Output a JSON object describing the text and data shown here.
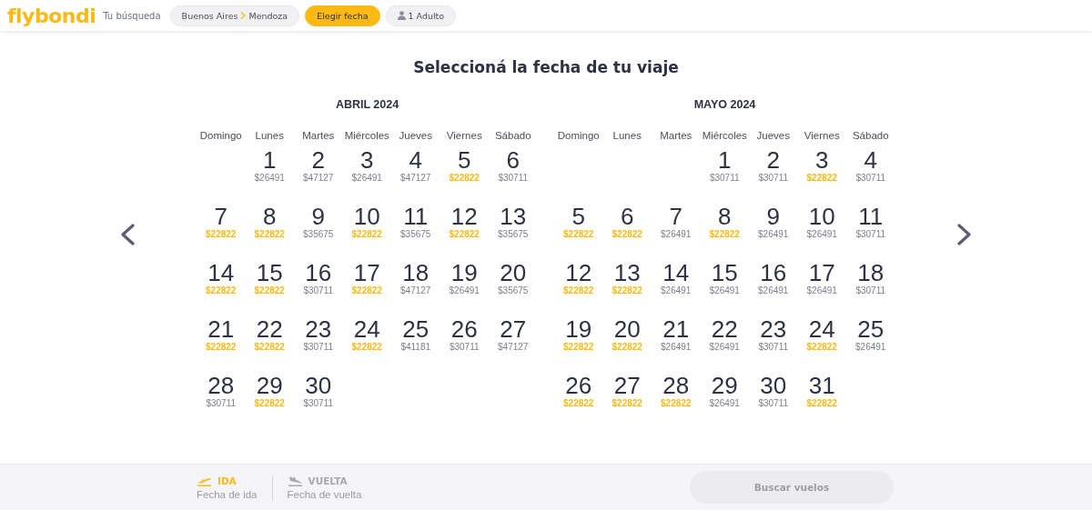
{
  "header": {
    "logo": "flybondi",
    "search_label": "Tu búsqueda",
    "route": {
      "origin": "Buenos Aires",
      "destination": "Mendoza",
      "selected": false
    },
    "date_button": {
      "label": "Elegir fecha",
      "selected": true
    },
    "passengers": {
      "label": "1 Adulto",
      "selected": false
    }
  },
  "title": "Seleccioná la fecha de tu viaje",
  "months": [
    {
      "name": "ABRIL 2024",
      "weekdays": [
        "Domingo",
        "Lunes",
        "Martes",
        "Miércoles",
        "Jueves",
        "Viernes",
        "Sábado"
      ],
      "days": [
        {
          "kind": "blank"
        },
        {
          "kind": "day",
          "day": "1",
          "price": "$26491",
          "cheapest": false
        },
        {
          "kind": "day",
          "day": "2",
          "price": "$47127",
          "cheapest": false
        },
        {
          "kind": "day",
          "day": "3",
          "price": "$26491",
          "cheapest": false
        },
        {
          "kind": "day",
          "day": "4",
          "price": "$47127",
          "cheapest": false
        },
        {
          "kind": "day",
          "day": "5",
          "price": "$22822",
          "cheapest": true
        },
        {
          "kind": "day",
          "day": "6",
          "price": "$30711",
          "cheapest": false
        },
        {
          "kind": "day",
          "day": "7",
          "price": "$22822",
          "cheapest": true
        },
        {
          "kind": "day",
          "day": "8",
          "price": "$22822",
          "cheapest": true
        },
        {
          "kind": "day",
          "day": "9",
          "price": "$35675",
          "cheapest": false
        },
        {
          "kind": "day",
          "day": "10",
          "price": "$22822",
          "cheapest": true
        },
        {
          "kind": "day",
          "day": "11",
          "price": "$35675",
          "cheapest": false
        },
        {
          "kind": "day",
          "day": "12",
          "price": "$22822",
          "cheapest": true
        },
        {
          "kind": "day",
          "day": "13",
          "price": "$35675",
          "cheapest": false
        },
        {
          "kind": "day",
          "day": "14",
          "price": "$22822",
          "cheapest": true
        },
        {
          "kind": "day",
          "day": "15",
          "price": "$22822",
          "cheapest": true
        },
        {
          "kind": "day",
          "day": "16",
          "price": "$30711",
          "cheapest": false
        },
        {
          "kind": "day",
          "day": "17",
          "price": "$22822",
          "cheapest": true
        },
        {
          "kind": "day",
          "day": "18",
          "price": "$47127",
          "cheapest": false
        },
        {
          "kind": "day",
          "day": "19",
          "price": "$26491",
          "cheapest": false
        },
        {
          "kind": "day",
          "day": "20",
          "price": "$35675",
          "cheapest": false
        },
        {
          "kind": "day",
          "day": "21",
          "price": "$22822",
          "cheapest": true
        },
        {
          "kind": "day",
          "day": "22",
          "price": "$22822",
          "cheapest": true
        },
        {
          "kind": "day",
          "day": "23",
          "price": "$30711",
          "cheapest": false
        },
        {
          "kind": "day",
          "day": "24",
          "price": "$22822",
          "cheapest": true
        },
        {
          "kind": "day",
          "day": "25",
          "price": "$41181",
          "cheapest": false
        },
        {
          "kind": "day",
          "day": "26",
          "price": "$30711",
          "cheapest": false
        },
        {
          "kind": "day",
          "day": "27",
          "price": "$47127",
          "cheapest": false
        },
        {
          "kind": "day",
          "day": "28",
          "price": "$30711",
          "cheapest": false
        },
        {
          "kind": "day",
          "day": "29",
          "price": "$22822",
          "cheapest": true
        },
        {
          "kind": "day",
          "day": "30",
          "price": "$30711",
          "cheapest": false
        }
      ]
    },
    {
      "name": "MAYO 2024",
      "weekdays": [
        "Domingo",
        "Lunes",
        "Martes",
        "Miércoles",
        "Jueves",
        "Viernes",
        "Sábado"
      ],
      "days": [
        {
          "kind": "blank"
        },
        {
          "kind": "blank"
        },
        {
          "kind": "blank"
        },
        {
          "kind": "day",
          "day": "1",
          "price": "$30711",
          "cheapest": false
        },
        {
          "kind": "day",
          "day": "2",
          "price": "$30711",
          "cheapest": false
        },
        {
          "kind": "day",
          "day": "3",
          "price": "$22822",
          "cheapest": true
        },
        {
          "kind": "day",
          "day": "4",
          "price": "$30711",
          "cheapest": false
        },
        {
          "kind": "day",
          "day": "5",
          "price": "$22822",
          "cheapest": true
        },
        {
          "kind": "day",
          "day": "6",
          "price": "$22822",
          "cheapest": true
        },
        {
          "kind": "day",
          "day": "7",
          "price": "$26491",
          "cheapest": false
        },
        {
          "kind": "day",
          "day": "8",
          "price": "$22822",
          "cheapest": true
        },
        {
          "kind": "day",
          "day": "9",
          "price": "$26491",
          "cheapest": false
        },
        {
          "kind": "day",
          "day": "10",
          "price": "$26491",
          "cheapest": false
        },
        {
          "kind": "day",
          "day": "11",
          "price": "$30711",
          "cheapest": false
        },
        {
          "kind": "day",
          "day": "12",
          "price": "$22822",
          "cheapest": true
        },
        {
          "kind": "day",
          "day": "13",
          "price": "$22822",
          "cheapest": true
        },
        {
          "kind": "day",
          "day": "14",
          "price": "$26491",
          "cheapest": false
        },
        {
          "kind": "day",
          "day": "15",
          "price": "$26491",
          "cheapest": false
        },
        {
          "kind": "day",
          "day": "16",
          "price": "$26491",
          "cheapest": false
        },
        {
          "kind": "day",
          "day": "17",
          "price": "$26491",
          "cheapest": false
        },
        {
          "kind": "day",
          "day": "18",
          "price": "$30711",
          "cheapest": false
        },
        {
          "kind": "day",
          "day": "19",
          "price": "$22822",
          "cheapest": true
        },
        {
          "kind": "day",
          "day": "20",
          "price": "$22822",
          "cheapest": true
        },
        {
          "kind": "day",
          "day": "21",
          "price": "$26491",
          "cheapest": false
        },
        {
          "kind": "day",
          "day": "22",
          "price": "$26491",
          "cheapest": false
        },
        {
          "kind": "day",
          "day": "23",
          "price": "$30711",
          "cheapest": false
        },
        {
          "kind": "day",
          "day": "24",
          "price": "$22822",
          "cheapest": true
        },
        {
          "kind": "day",
          "day": "25",
          "price": "$26491",
          "cheapest": false
        },
        {
          "kind": "day",
          "day": "26",
          "price": "$22822",
          "cheapest": true
        },
        {
          "kind": "day",
          "day": "27",
          "price": "$22822",
          "cheapest": true
        },
        {
          "kind": "day",
          "day": "28",
          "price": "$22822",
          "cheapest": true
        },
        {
          "kind": "day",
          "day": "29",
          "price": "$26491",
          "cheapest": false
        },
        {
          "kind": "day",
          "day": "30",
          "price": "$30711",
          "cheapest": false
        },
        {
          "kind": "day",
          "day": "31",
          "price": "$22822",
          "cheapest": true
        }
      ]
    }
  ],
  "footer": {
    "legs": [
      {
        "kind": "departure",
        "label": "IDA",
        "placeholder": "Fecha de ida",
        "selected": true
      },
      {
        "kind": "return",
        "label": "VUELTA",
        "placeholder": "Fecha de vuelta",
        "selected": false
      }
    ],
    "search_button": {
      "label": "Buscar vuelos",
      "disabled": true
    }
  }
}
